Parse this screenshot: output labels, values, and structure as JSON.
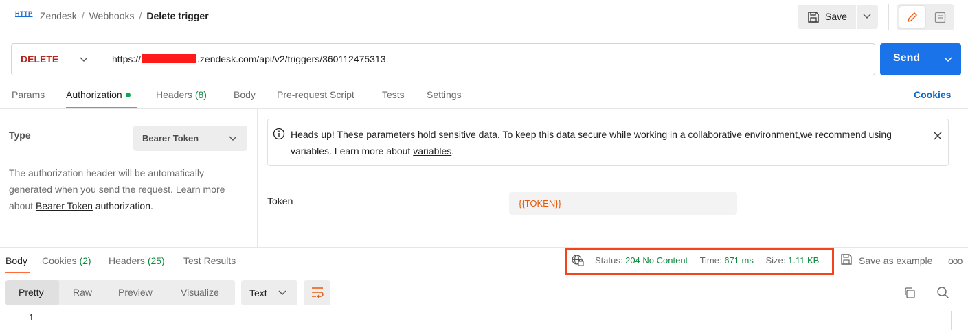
{
  "header": {
    "icon_label": "HTTP",
    "breadcrumb": [
      "Zendesk",
      "Webhooks"
    ],
    "current": "Delete trigger",
    "save_label": "Save"
  },
  "request": {
    "method": "DELETE",
    "url_prefix": "https://",
    "url_suffix": ".zendesk.com/api/v2/triggers/360112475313",
    "send_label": "Send"
  },
  "request_tabs": {
    "params": "Params",
    "authorization": "Authorization",
    "headers": "Headers",
    "headers_count": "(8)",
    "body": "Body",
    "prerequest": "Pre-request Script",
    "tests": "Tests",
    "settings": "Settings",
    "cookies": "Cookies"
  },
  "auth": {
    "type_label": "Type",
    "type_value": "Bearer Token",
    "desc_before": "The authorization header will be automatically generated when you send the request. Learn more about ",
    "desc_link": "Bearer Token",
    "desc_after": " authorization.",
    "notice_text": "Heads up! These parameters hold sensitive data. To keep this data secure while working in a collaborative environment,we recommend using variables. Learn more about ",
    "notice_link": "variables",
    "notice_end": ".",
    "token_label": "Token",
    "token_value": "{{TOKEN}}"
  },
  "response_tabs": {
    "body": "Body",
    "cookies": "Cookies",
    "cookies_count": "(2)",
    "headers": "Headers",
    "headers_count": "(25)",
    "test_results": "Test Results"
  },
  "response_meta": {
    "status_label": "Status:",
    "status_value": "204 No Content",
    "time_label": "Time:",
    "time_value": "671 ms",
    "size_label": "Size:",
    "size_value": "1.11 KB",
    "save_example": "Save as example",
    "more": "ooo"
  },
  "body_view": {
    "modes": [
      "Pretty",
      "Raw",
      "Preview",
      "Visualize"
    ],
    "format": "Text",
    "line_number": "1"
  },
  "colors": {
    "accent": "#ff6c37",
    "send": "#1a73e8",
    "method_delete": "#b3261e",
    "success": "#0b8a3c",
    "highlight_box": "#f2451d"
  },
  "icons": [
    "http-icon",
    "save-icon",
    "chevron-down-icon",
    "pencil-icon",
    "comment-icon",
    "info-icon",
    "close-icon",
    "globe-icon",
    "wrap-icon",
    "copy-icon",
    "search-icon",
    "more-icon"
  ]
}
